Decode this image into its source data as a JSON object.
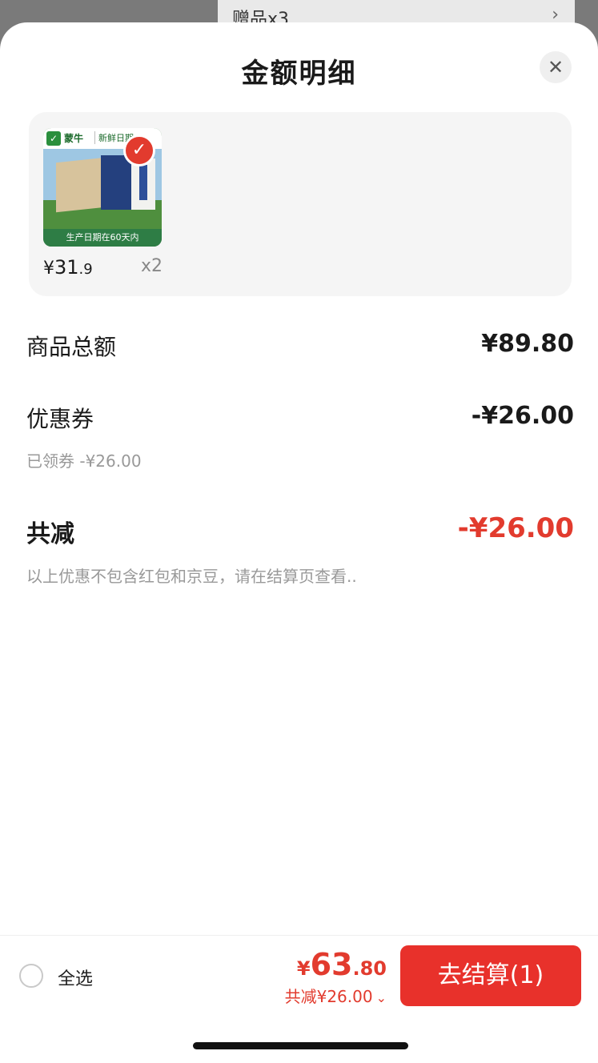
{
  "background": {
    "text": "赠品x3",
    "chevron": "›"
  },
  "sheet": {
    "title": "金额明细",
    "close_icon": "✕"
  },
  "product": {
    "brand": "蒙牛",
    "tag": "新鲜日期",
    "footer_text": "生产日期在60天内",
    "price_symbol": "¥",
    "price_int": "31",
    "price_dec": ".9",
    "quantity": "x2",
    "selected": true
  },
  "summary": {
    "goods_total_label": "商品总额",
    "goods_total_value": "¥89.80",
    "coupon_label": "优惠券",
    "coupon_value": "-¥26.00",
    "coupon_note": "已领券 -¥26.00",
    "total_discount_label": "共减",
    "total_discount_value": "-¥26.00",
    "disclaimer": "以上优惠不包含红包和京豆，请在结算页查看.."
  },
  "footer": {
    "select_all_label": "全选",
    "pay_symbol": "¥",
    "pay_int": "63",
    "pay_dec": ".80",
    "saved_text": "共减¥26.00",
    "saved_chevron": "⌄",
    "checkout_label": "去结算(1)"
  },
  "colors": {
    "accent_red": "#e8312b",
    "price_red": "#e23b2e",
    "brand_green": "#2e7d45"
  }
}
